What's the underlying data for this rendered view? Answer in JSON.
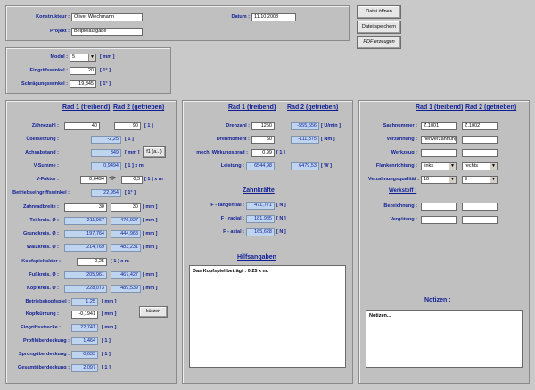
{
  "top": {
    "konstrukteur_label": "Konstrukteur :",
    "konstrukteur_value": "Oliver Wiechmann",
    "projekt_label": "Projekt :",
    "projekt_value": "Beipielaufgabe",
    "datum_label": "Datum :",
    "datum_value": "11.10.2008"
  },
  "buttons": {
    "open": "Datei öffnen",
    "save": "Datei speichern",
    "pdf": "PDF erzeugen",
    "f1": "f1 (a...)",
    "kuerzen": "kürzen"
  },
  "general": {
    "modul_label": "Modul :",
    "modul_value": "5",
    "modul_unit": "[ mm ]",
    "eingriff_label": "Eingriffswinkel :",
    "eingriff_value": "20",
    "eingriff_unit": "[ 1° ]",
    "schraeg_label": "Schrägungswinkel :",
    "schraeg_value": "19,345",
    "schraeg_unit": "[ 1° ]"
  },
  "headers": {
    "rad1": "Rad 1 (treibend)",
    "rad2": "Rad 2 (getrieben)",
    "zahnkraefte": "Zahnkräfte",
    "hilfsangaben": "Hilfsangaben",
    "notizen": "Notizen :",
    "werkstoff": "Werkstoff :"
  },
  "geometry": {
    "zaehnezahl": {
      "label": "Zähnezahl :",
      "r1": "40",
      "r2": "90",
      "unit": "[ 1 ]"
    },
    "uebersetzung": {
      "label": "Übersetzung :",
      "value": "-2,25",
      "unit": "[ 1 ]"
    },
    "achsabstand": {
      "label": "Achsabstand :",
      "value": "349",
      "unit": "[ mm ]"
    },
    "vsumme": {
      "label": "V-Summe :",
      "value": "0,9494",
      "unit": "[ 1 ] x m"
    },
    "vfaktor": {
      "label": "V-Faktor :",
      "r1": "0,6494",
      "arrows": "<|>",
      "r2": "0,3",
      "unit": "[ 1 ] x m"
    },
    "betriebseingriff": {
      "label": "Betriebseingriffswinkel :",
      "value": "22,954",
      "unit": "[ 1° ]"
    },
    "zahnradbreite": {
      "label": "Zahnradbreite :",
      "r1": "30",
      "r2": "30",
      "unit": "[ mm ]"
    },
    "teilkreis": {
      "label": "Teilkreis. Ø :",
      "r1": "211,967",
      "r2": "476,927",
      "unit": "[ mm ]"
    },
    "grundkreis": {
      "label": "Grundkreis. Ø :",
      "r1": "197,764",
      "r2": "444,968",
      "unit": "[ mm ]"
    },
    "waelzkreis": {
      "label": "Wälzkreis. Ø :",
      "r1": "214,769",
      "r2": "483,231",
      "unit": "[ mm ]"
    },
    "kopfspielfaktor": {
      "label": "Kopfspielfaktor :",
      "value": "0,25",
      "unit": "[ 1 ] x m"
    },
    "fusskreis": {
      "label": "Fußkreis. Ø :",
      "r1": "205,961",
      "r2": "467,427",
      "unit": "[ mm ]"
    },
    "kopfkreis": {
      "label": "Kopfkreis. Ø :",
      "r1": "228,073",
      "r2": "489,539",
      "unit": "[ mm ]"
    },
    "betriebskopfspiel": {
      "label": "Betriebskopfspiel :",
      "value": "1,25",
      "unit": "[ mm ]"
    },
    "kopfkuerzung": {
      "label": "Kopfkürzung :",
      "value": "-0,1941",
      "unit": "[ mm ]"
    },
    "eingriffsstrecke": {
      "label": "Eingriffsstrecke :",
      "value": "22,741",
      "unit": "[ mm ]"
    },
    "profilueberdeckung": {
      "label": "Profilüberdeckung :",
      "value": "1,464",
      "unit": "[ 1 ]"
    },
    "sprungueberdeckung": {
      "label": "Sprungüberdeckung :",
      "value": "0,633",
      "unit": "[ 1 ]"
    },
    "gesamtueberdeckung": {
      "label": "Gesamtüberdeckung :",
      "value": "2,097",
      "unit": "[ 1 ]"
    }
  },
  "drive": {
    "drehzahl": {
      "label": "Drehzahl :",
      "r1": "1250",
      "r2": "-555,556",
      "unit": "[ U/min ]"
    },
    "drehmoment": {
      "label": "Drehmoment :",
      "r1": "50",
      "r2": "-111,375",
      "unit": "[ Nm ]"
    },
    "wirkungsgrad": {
      "label": "mech. Wirkungsgrad :",
      "value": "0,99",
      "unit": "[ 1 ]"
    },
    "leistung": {
      "label": "Leistung :",
      "r1": "6544,98",
      "r2": "6479,53",
      "unit": "[ W ]"
    },
    "ftangential": {
      "label": "F - tangential :",
      "value": "471,771",
      "unit": "[ N ]"
    },
    "fradial": {
      "label": "F - radial :",
      "value": "181,985",
      "unit": "[ N ]"
    },
    "faxial": {
      "label": "F - axial :",
      "value": "165,628",
      "unit": "[ N ]"
    },
    "hilfs_text": "Das Kopfspiel beträgt : 0,25 x m."
  },
  "production": {
    "sachnummer": {
      "label": "Sachnummer :",
      "r1": "Z.1001",
      "r2": "Z.1002"
    },
    "verzahnung": {
      "label": "Verzahnung :",
      "r1": "nenverzahnung",
      "r2": ""
    },
    "werkzeug": {
      "label": "Werkzeug :",
      "r1": "",
      "r2": ""
    },
    "flankenrichtung": {
      "label": "Flankenrichtung :",
      "r1": "links",
      "r2": "rechts"
    },
    "qualitaet": {
      "label": "Verzahnungsqualität :",
      "r1": "10",
      "r2": "9"
    },
    "bezeichnung": {
      "label": "Bezeichnung :",
      "r1": "",
      "r2": ""
    },
    "verguetung": {
      "label": "Vergütung :",
      "r1": "",
      "r2": ""
    },
    "notizen_text": "Notizen..."
  }
}
